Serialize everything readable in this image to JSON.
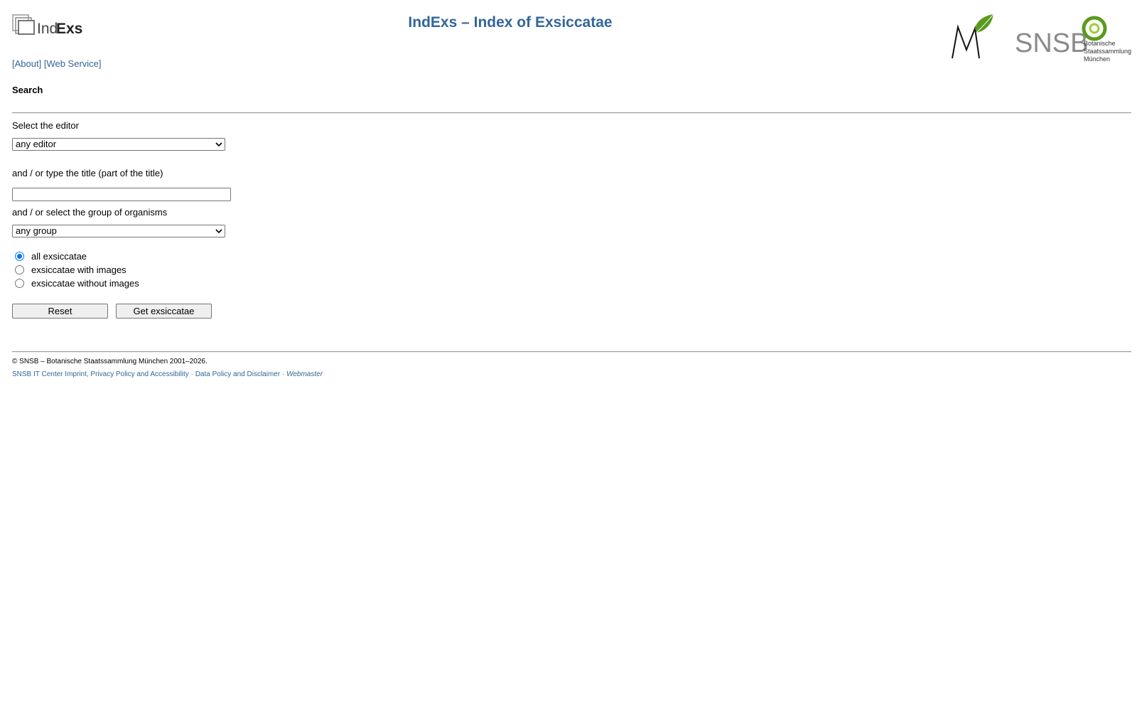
{
  "header": {
    "logo_text_left": "Ind",
    "logo_text_right": "Exs",
    "title": "IndExs – Index of Exsiccatae",
    "partner_logo_snsb": "SNSB",
    "partner_logo_snsb_caption": [
      "Botanische",
      "Staatssammlung",
      "München"
    ]
  },
  "nav": {
    "about": "[About]",
    "web_service": "[Web Service]"
  },
  "search": {
    "heading": "Search",
    "editor_label": "Select the editor",
    "editor_selected": "any editor",
    "title_label": "and / or type the title (part of the title)",
    "title_value": "",
    "group_label": "and / or select the group of organisms",
    "group_selected": "any group",
    "radio_options": [
      {
        "label": "all exsiccatae",
        "checked": true
      },
      {
        "label": "exsiccatae with images",
        "checked": false
      },
      {
        "label": "exsiccatae without images",
        "checked": false
      }
    ],
    "reset_label": "Reset",
    "submit_label": "Get exsiccatae"
  },
  "footer": {
    "copyright": "© SNSB – Botanische Staatssammlung München 2001–2026.",
    "imprint": "SNSB IT Center Imprint, Privacy Policy and Accessibility",
    "data_policy": "Data Policy and Disclaimer",
    "webmaster": "Webmaster",
    "separator": " · "
  },
  "colors": {
    "link": "#336699",
    "radio_accent": "#0075ff",
    "logo_green": "#5a9a1e",
    "snsb_grey": "#8a8a8a"
  }
}
